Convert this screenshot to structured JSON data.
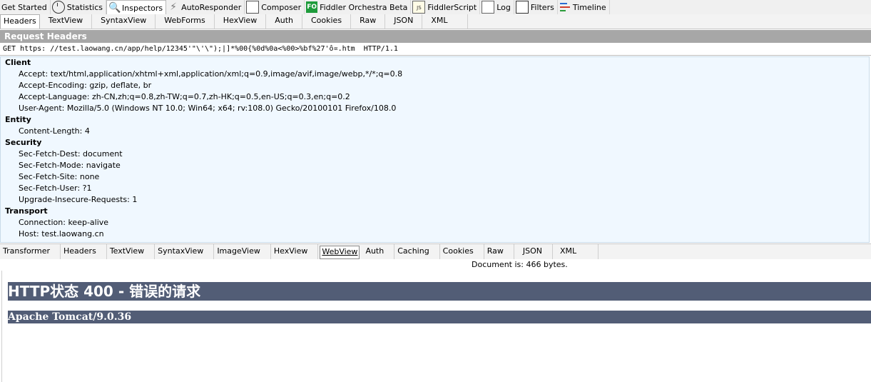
{
  "top_tabs": {
    "get_started": "Get Started",
    "statistics": "Statistics",
    "inspectors": "Inspectors",
    "autoresponder": "AutoResponder",
    "composer": "Composer",
    "orchestra": "Fiddler Orchestra Beta",
    "orchestra_badge": "FO",
    "script": "FiddlerScript",
    "log": "Log",
    "filters": "Filters",
    "timeline": "Timeline"
  },
  "request_tabs": [
    "Headers",
    "TextView",
    "SyntaxView",
    "WebForms",
    "HexView",
    "Auth",
    "Cookies",
    "Raw",
    "JSON",
    "XML"
  ],
  "request_headers": {
    "title": "Request Headers",
    "request_line": "GET https: //test.laowang.cn/app/help/12345'\"\\'\\\");|]*%00{%0d%0a<%00>%bf%27'ô¤.htm  HTTP/1.1",
    "groups": [
      {
        "name": "Client",
        "items": [
          "Accept: text/html,application/xhtml+xml,application/xml;q=0.9,image/avif,image/webp,*/*;q=0.8",
          "Accept-Encoding: gzip, deflate, br",
          "Accept-Language: zh-CN,zh;q=0.8,zh-TW;q=0.7,zh-HK;q=0.5,en-US;q=0.3,en;q=0.2",
          "User-Agent: Mozilla/5.0 (Windows NT 10.0; Win64; x64; rv:108.0) Gecko/20100101 Firefox/108.0"
        ]
      },
      {
        "name": "Entity",
        "items": [
          "Content-Length: 4"
        ]
      },
      {
        "name": "Security",
        "items": [
          "Sec-Fetch-Dest: document",
          "Sec-Fetch-Mode: navigate",
          "Sec-Fetch-Site: none",
          "Sec-Fetch-User: ?1",
          "Upgrade-Insecure-Requests: 1"
        ]
      },
      {
        "name": "Transport",
        "items": [
          "Connection: keep-alive",
          "Host: test.laowang.cn"
        ]
      }
    ]
  },
  "response_tabs": [
    "Transformer",
    "Headers",
    "TextView",
    "SyntaxView",
    "ImageView",
    "HexView",
    "WebView",
    "Auth",
    "Caching",
    "Cookies",
    "Raw",
    "JSON",
    "XML"
  ],
  "response": {
    "document_size": "Document is: 466 bytes.",
    "h1": "HTTP状态 400 - 错误的请求",
    "h3": "Apache Tomcat/9.0.36"
  },
  "colors": {
    "tomcat_bar": "#525d76",
    "headers_bg": "#f0f8ff",
    "section_title_bg": "#a7a7a7"
  }
}
